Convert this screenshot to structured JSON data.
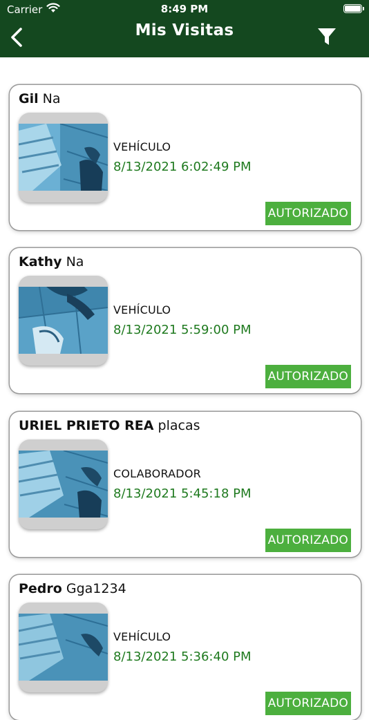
{
  "status_bar": {
    "carrier": "Carrier",
    "time": "8:49 PM"
  },
  "nav": {
    "title": "Mis Visitas"
  },
  "colors": {
    "header_bg": "#14481f",
    "date_text": "#1f7a1f",
    "badge_bg": "#4caf3e"
  },
  "visits": [
    {
      "first_name": "Gil",
      "rest": " Na",
      "type": "VEHÍCULO",
      "datetime": "8/13/2021 6:02:49 PM",
      "status": "AUTORIZADO"
    },
    {
      "first_name": "Kathy",
      "rest": " Na",
      "type": "VEHÍCULO",
      "datetime": "8/13/2021 5:59:00 PM",
      "status": "AUTORIZADO"
    },
    {
      "first_name": "URIEL PRIETO REA",
      "rest": " placas",
      "type": "COLABORADOR",
      "datetime": "8/13/2021 5:45:18 PM",
      "status": "AUTORIZADO"
    },
    {
      "first_name": "Pedro",
      "rest": " Gga1234",
      "type": "VEHÍCULO",
      "datetime": "8/13/2021 5:36:40 PM",
      "status": "AUTORIZADO"
    }
  ]
}
